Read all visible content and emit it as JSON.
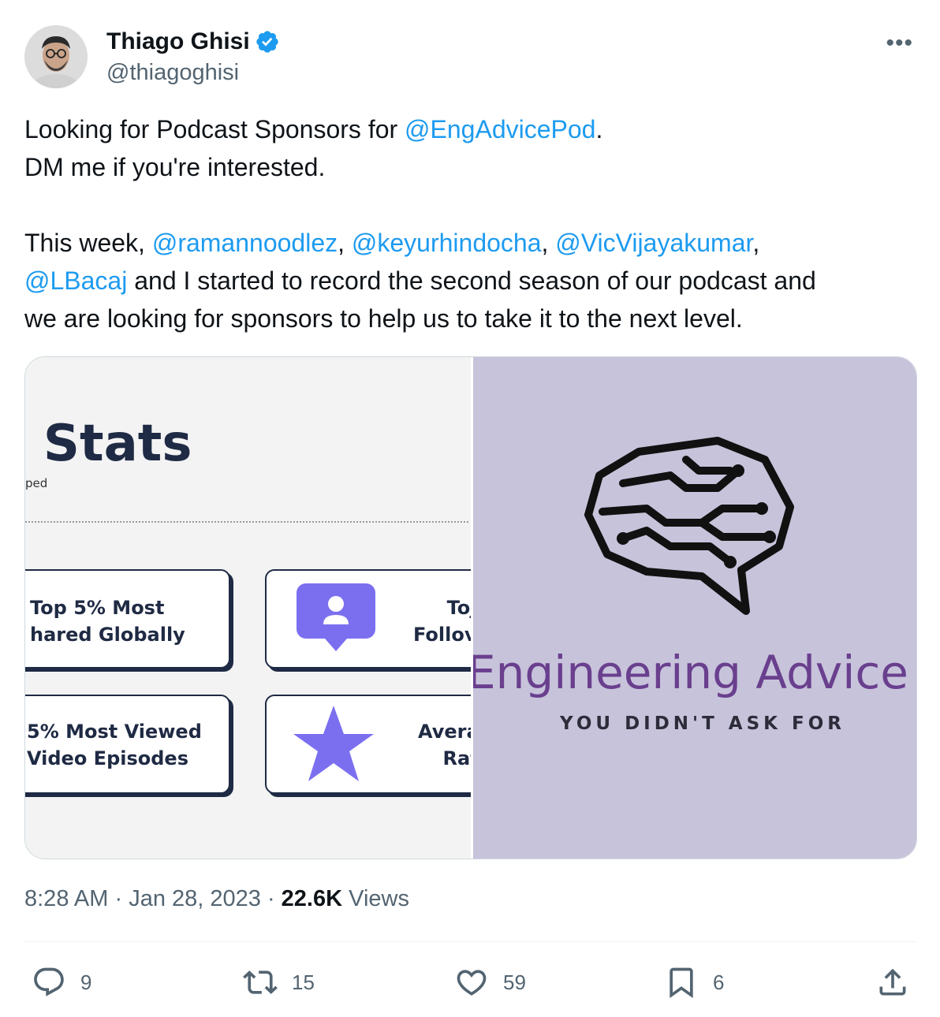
{
  "author": {
    "name": "Thiago Ghisi",
    "handle": "@thiagoghisi"
  },
  "menu_icon": "more-icon",
  "tweet": {
    "line1_a": "Looking for Podcast Sponsors for ",
    "line1_mention": "@EngAdvicePod",
    "line1_b": ".",
    "line2": "DM me if you're interested.",
    "line4_a": "This week, ",
    "mention_1": "@ramannoodlez",
    "sep_1": ", ",
    "mention_2": "@keyurhindocha",
    "sep_2": ", ",
    "mention_3": "@VicVijayakumar",
    "sep_3": ",",
    "mention_4": "@LBacaj",
    "line5_b": " and I started to record the second season of our podcast and",
    "line6": "we are looking for sponsors to help us to take it to the next level."
  },
  "media": {
    "left": {
      "title": "t Stats",
      "subtitle": "ped",
      "card1": "Top 5% Most\nhared Globally",
      "card2": "Toj\nFollov",
      "card3": "5% Most Viewed\nVideo Episodes",
      "card4": "Avera\nRat"
    },
    "right": {
      "title": "Engineering Advice",
      "subtitle": "YOU DIDN'T ASK FOR"
    }
  },
  "meta": {
    "time": "8:28 AM",
    "dot1": " · ",
    "date": "Jan 28, 2023",
    "dot2": " · ",
    "views_count": "22.6K",
    "views_label": " Views"
  },
  "actions": {
    "replies": "9",
    "retweets": "15",
    "likes": "59",
    "bookmarks": "6"
  },
  "colors": {
    "link": "#1d9bf0",
    "secondary": "#536471",
    "brand_purple": "#6a3f8e",
    "card_icon": "#7b6ff0"
  }
}
